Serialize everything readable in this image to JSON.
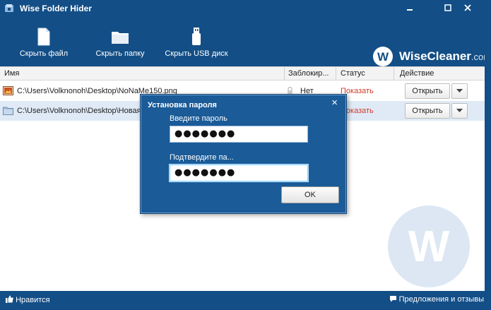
{
  "window": {
    "title": "Wise Folder Hider",
    "controls": [
      "minimize-icon",
      "maximize-icon",
      "close-icon"
    ]
  },
  "toolbar": {
    "hide_file": "Скрыть файл",
    "hide_folder": "Скрыть папку",
    "hide_usb": "Скрыть USB диск"
  },
  "brand": {
    "name": "WiseCleaner",
    "suffix": ".com"
  },
  "table": {
    "headers": {
      "name": "Имя",
      "locked": "Заблокир...",
      "status": "Статус",
      "action": "Действие"
    },
    "rows": [
      {
        "icon": "image-file-icon",
        "path": "C:\\Users\\Volknonoh\\Desktop\\NoNaMe150.png",
        "locked": "Нет",
        "status": "Показать",
        "action": "Открыть"
      },
      {
        "icon": "folder-icon",
        "path": "C:\\Users\\Volknonoh\\Desktop\\Новая",
        "locked": "",
        "status": "Показать",
        "action": "Открыть"
      }
    ]
  },
  "dialog": {
    "title": "Установка пароля",
    "password_label": "Введите пароль",
    "password_value": "●●●●●●●",
    "confirm_label": "Подтвердите па...",
    "confirm_value": "●●●●●●●",
    "ok": "OK"
  },
  "statusbar": {
    "like": "Нравится",
    "feedback": "Предложения и отзывы"
  },
  "colors": {
    "chrome": "#134e86",
    "dialog": "#1a5b98",
    "status_link": "#d23a2a",
    "selected_row": "#dfeaf6"
  }
}
